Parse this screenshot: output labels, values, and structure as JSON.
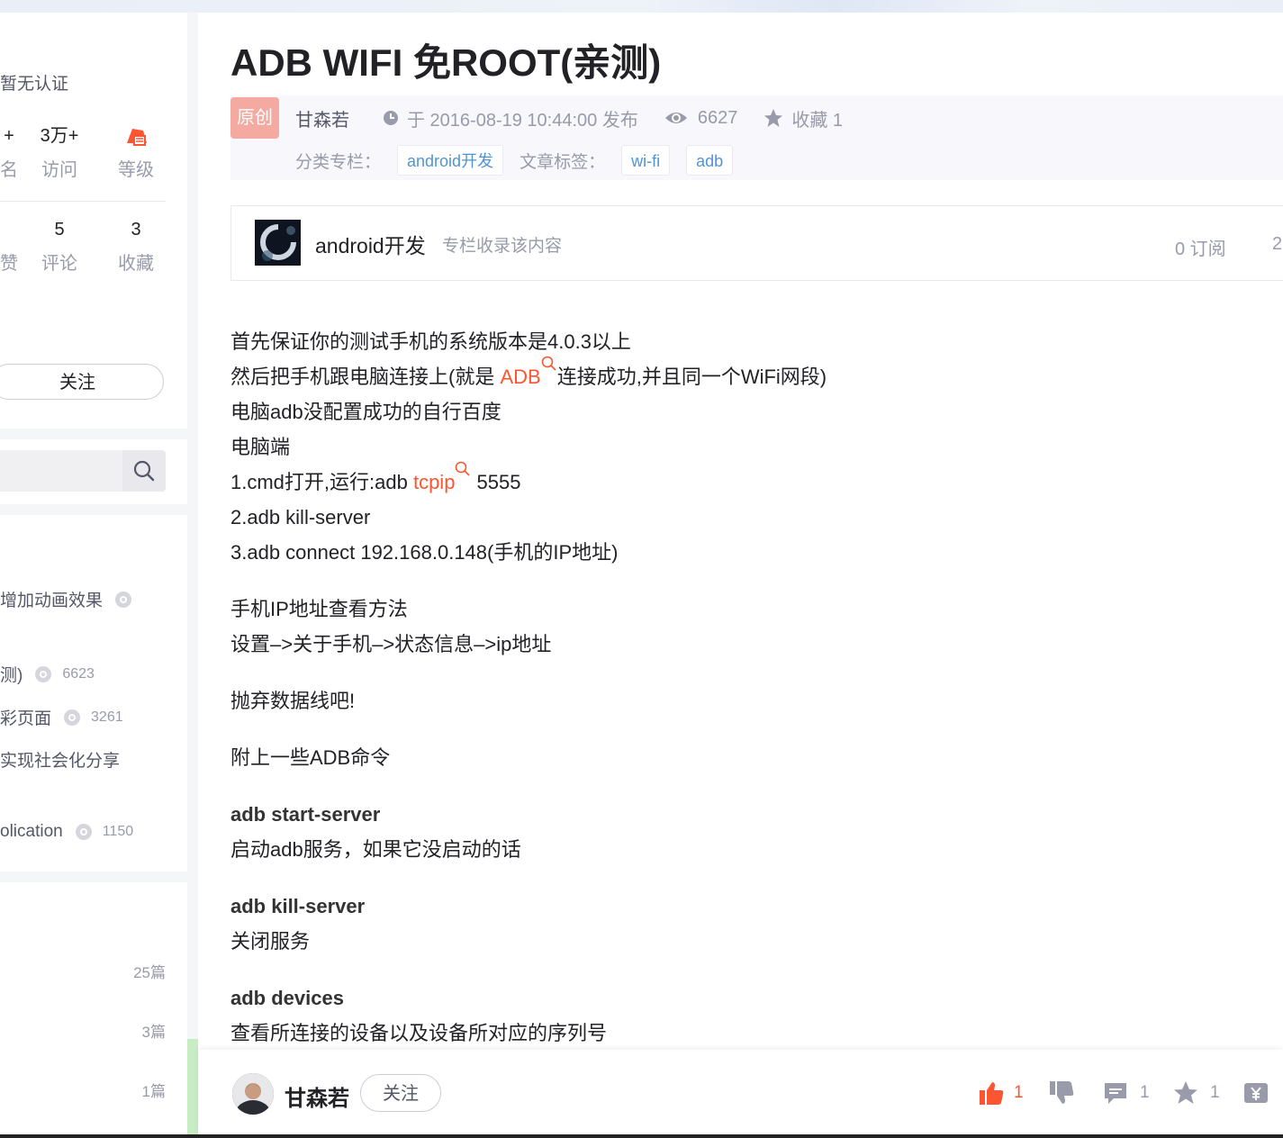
{
  "sidebar": {
    "verify_text": "暂无认证",
    "stats_row1": [
      {
        "num": "+",
        "label": "名"
      },
      {
        "num": "3万+",
        "label": "访问"
      },
      {
        "num": "",
        "label": "等级"
      }
    ],
    "stats_row2": [
      {
        "num": "",
        "label": "赞"
      },
      {
        "num": "5",
        "label": "评论"
      },
      {
        "num": "3",
        "label": "收藏"
      }
    ],
    "follow_label": "关注",
    "hot_articles": [
      {
        "title": "增加动画效果",
        "views": ""
      },
      {
        "title": "测)",
        "views": "6623"
      },
      {
        "title": "彩页面",
        "views": "3261"
      },
      {
        "title": "实现社会化分享",
        "views": ""
      },
      {
        "title": "olication",
        "views": "1150"
      }
    ],
    "categories": [
      {
        "count": "25篇"
      },
      {
        "count": "3篇"
      },
      {
        "count": "1篇"
      }
    ]
  },
  "article": {
    "title": "ADB WIFI 免ROOT(亲测)",
    "badge": "原创",
    "author": "甘森若",
    "published": "于 2016-08-19 10:44:00 发布",
    "views": "6627",
    "favorites": "收藏 1",
    "category_label": "分类专栏：",
    "categories": [
      "android开发"
    ],
    "tags_label": "文章标签：",
    "tags": [
      "wi-fi",
      "adb"
    ]
  },
  "column": {
    "name": "android开发",
    "desc": "专栏收录该内容",
    "subscribers": "0 订阅",
    "more": "2"
  },
  "content": {
    "line1": "首先保证你的测试手机的系统版本是4.0.3以上",
    "line2_pre": "然后把手机跟电脑连接上(就是 ",
    "line2_kw": "ADB",
    "line2_post": "连接成功,并且同一个WiFi网段)",
    "line3": "电脑adb没配置成功的自行百度",
    "line4": "电脑端",
    "line5_pre": "1.cmd打开,运行:adb ",
    "line5_kw": "tcpip",
    "line5_post": " 5555",
    "line6": "2.adb kill-server",
    "line7": "3.adb connect 192.168.0.148(手机的IP地址)",
    "line8": "手机IP地址查看方法",
    "line9": "设置–>关于手机–>状态信息–>ip地址",
    "line10": "抛弃数据线吧!",
    "line11": "附上一些ADB命令",
    "cmd1": "adb start-server",
    "cmd1_desc": "启动adb服务，如果它没启动的话",
    "cmd2": "adb kill-server",
    "cmd2_desc": "关闭服务",
    "cmd3": "adb devices",
    "cmd3_desc": "查看所连接的设备以及设备所对应的序列号"
  },
  "bottom_bar": {
    "author": "甘森若",
    "follow": "关注",
    "likes": "1",
    "comments": "1",
    "favorites": "1"
  },
  "colors": {
    "accent": "#fc5531",
    "badge_bg": "#f4aaa0",
    "tag_text": "#5094d5"
  }
}
